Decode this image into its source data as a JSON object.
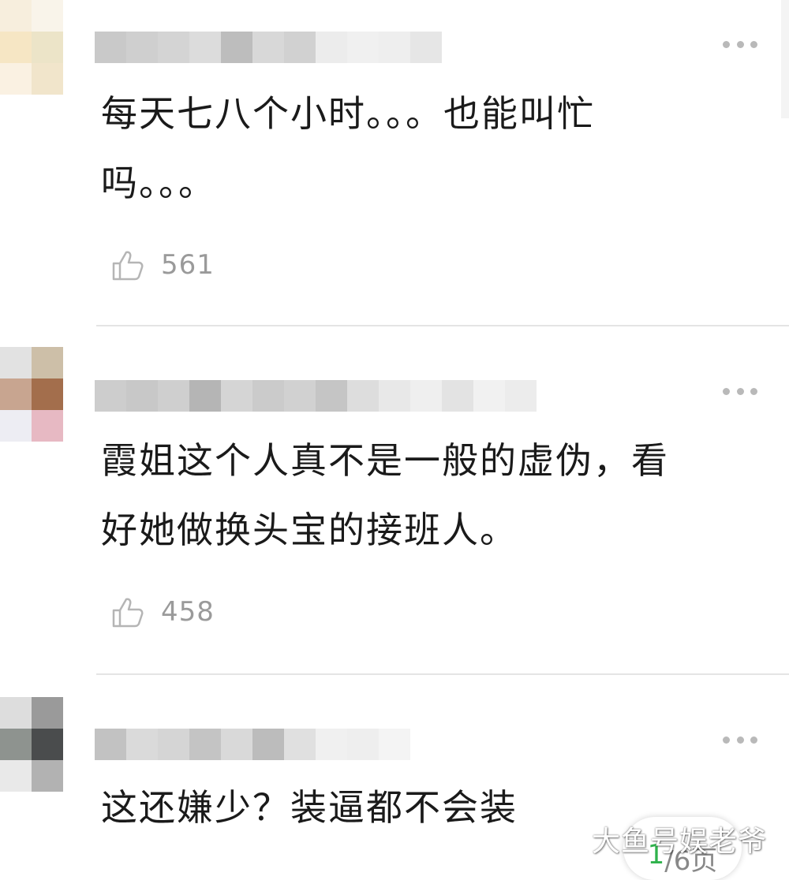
{
  "comments": [
    {
      "text": "每天七八个小时。。。也能叫忙\n吗。。。",
      "likes": "561",
      "avatar_colors": [
        "#f7eedd",
        "#f9f4ea",
        "#f6e6c4",
        "#ece4c8",
        "#faf1e2",
        "#f1e5cb"
      ],
      "name_colors": [
        "#c9c9c9",
        "#cfcfcf",
        "#d4d4d4",
        "#dcdcdc",
        "#bdbdbd",
        "#d8d8d8",
        "#d1d1d1",
        "#ececec",
        "#f0f0f0",
        "#eeeeee",
        "#e6e6e6"
      ]
    },
    {
      "text": "霞姐这个人真不是一般的虚伪，看\n好她做换头宝的接班人。",
      "likes": "458",
      "avatar_colors": [
        "#e2e2e2",
        "#cdbfa8",
        "#c8a590",
        "#a36e4c",
        "#ededf3",
        "#e7b9c3"
      ],
      "name_colors": [
        "#cdcdcd",
        "#c8c8c8",
        "#cfcfcf",
        "#b5b5b5",
        "#d5d5d5",
        "#cbcbcb",
        "#d1d1d1",
        "#c5c5c5",
        "#dddddd",
        "#e8e8e8",
        "#efefef",
        "#e3e3e3",
        "#f1f1f1",
        "#ececec"
      ]
    },
    {
      "text": "这还嫌少？装逼都不会装",
      "avatar_colors": [
        "#dddddd",
        "#9a9a9a",
        "#8e938f",
        "#4a4c4d",
        "#e9e9e9",
        "#b2b2b2"
      ],
      "name_colors": [
        "#c2c2c2",
        "#dadada",
        "#d5d5d5",
        "#c4c4c4",
        "#d9d9d9",
        "#bcbcbc",
        "#e0e0e0",
        "#f0f0f0",
        "#eeeeee",
        "#f4f4f4"
      ]
    }
  ],
  "pager": {
    "current": "1",
    "rest": "/6页"
  },
  "watermark": "大鱼号娱老爷",
  "colors": {
    "like_icon": "#b5b5b5",
    "more_dots": "#b9b9b9"
  }
}
